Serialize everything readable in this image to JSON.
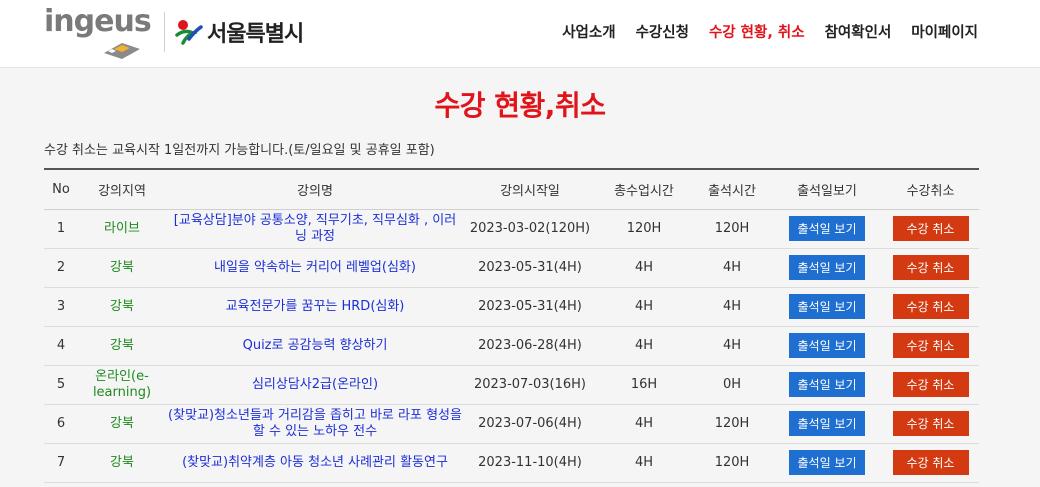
{
  "header": {
    "brand_ingeus": "ingeus",
    "brand_seoul": "서울특별시",
    "nav": [
      {
        "label": "사업소개",
        "active": false
      },
      {
        "label": "수강신청",
        "active": false
      },
      {
        "label": "수강 현황, 취소",
        "active": true
      },
      {
        "label": "참여확인서",
        "active": false
      },
      {
        "label": "마이페이지",
        "active": false
      }
    ]
  },
  "main": {
    "title": "수강 현황,취소",
    "notice": "수강 취소는 교육시작 1일전까지 가능합니다.(토/일요일 및 공휴일 포함)",
    "table": {
      "columns": [
        "No",
        "강의지역",
        "강의명",
        "강의시작일",
        "총수업시간",
        "출석시간",
        "출석일보기",
        "수강취소"
      ],
      "attendance_btn": "출석일 보기",
      "cancel_btn": "수강 취소",
      "rows": [
        {
          "no": "1",
          "region": "라이브",
          "course": "[교육상담]분야 공통소양, 직무기초, 직무심화 , 이러닝 과정",
          "start": "2023-03-02(120H)",
          "total": "120H",
          "attended": "120H"
        },
        {
          "no": "2",
          "region": "강북",
          "course": "내일을 약속하는 커리어 레벨업(심화)",
          "start": "2023-05-31(4H)",
          "total": "4H",
          "attended": "4H"
        },
        {
          "no": "3",
          "region": "강북",
          "course": "교육전문가를 꿈꾸는 HRD(심화)",
          "start": "2023-05-31(4H)",
          "total": "4H",
          "attended": "4H"
        },
        {
          "no": "4",
          "region": "강북",
          "course": "Quiz로 공감능력 향상하기",
          "start": "2023-06-28(4H)",
          "total": "4H",
          "attended": "4H"
        },
        {
          "no": "5",
          "region": "온라인(e-learning)",
          "course": "심리상담사2급(온라인)",
          "start": "2023-07-03(16H)",
          "total": "16H",
          "attended": "0H"
        },
        {
          "no": "6",
          "region": "강북",
          "course": "(찾맞교)청소년들과 거리감을 좁히고 바로 라포 형성을 할 수 있는 노하우 전수",
          "start": "2023-07-06(4H)",
          "total": "4H",
          "attended": "120H"
        },
        {
          "no": "7",
          "region": "강북",
          "course": "(찾맞교)취약계층 아동 청소년 사례관리 활동연구",
          "start": "2023-11-10(4H)",
          "total": "4H",
          "attended": "120H"
        }
      ]
    }
  }
}
